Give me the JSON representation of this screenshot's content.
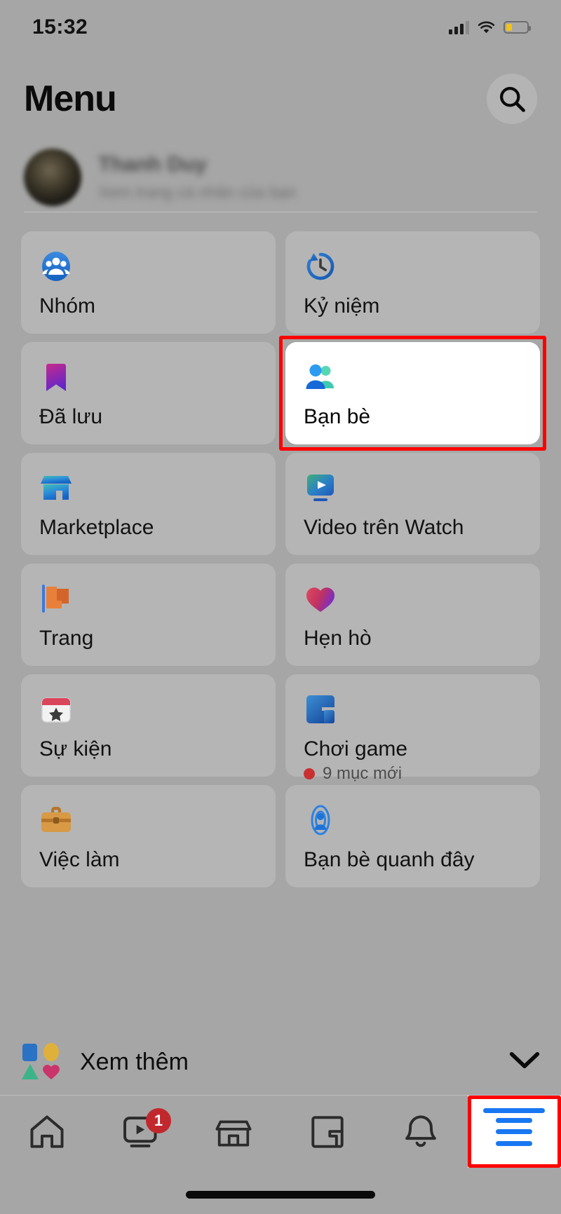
{
  "status_bar": {
    "time": "15:32",
    "signal_icon": "cellular-bars-icon",
    "wifi_icon": "wifi-icon",
    "battery_icon": "battery-low-icon",
    "battery_color": "#f0c419"
  },
  "header": {
    "title": "Menu",
    "search_icon": "search-icon"
  },
  "profile": {
    "name": "Thanh Duy",
    "subtitle": "Xem trang cá nhân của bạn",
    "avatar_icon": "avatar"
  },
  "tiles": [
    {
      "id": "groups",
      "label": "Nhóm",
      "icon": "groups-icon",
      "sub": null,
      "highlighted": false
    },
    {
      "id": "memories",
      "label": "Kỷ niệm",
      "icon": "memories-clock-icon",
      "sub": null,
      "highlighted": false
    },
    {
      "id": "saved",
      "label": "Đã lưu",
      "icon": "bookmark-icon",
      "sub": null,
      "highlighted": false
    },
    {
      "id": "friends",
      "label": "Bạn bè",
      "icon": "friends-icon",
      "sub": null,
      "highlighted": true
    },
    {
      "id": "marketplace",
      "label": "Marketplace",
      "icon": "marketplace-shop-icon",
      "sub": null,
      "highlighted": false
    },
    {
      "id": "watch",
      "label": "Video trên Watch",
      "icon": "watch-play-icon",
      "sub": null,
      "highlighted": false
    },
    {
      "id": "pages",
      "label": "Trang",
      "icon": "pages-flag-icon",
      "sub": null,
      "highlighted": false
    },
    {
      "id": "dating",
      "label": "Hẹn hò",
      "icon": "dating-heart-icon",
      "sub": null,
      "highlighted": false
    },
    {
      "id": "events",
      "label": "Sự kiện",
      "icon": "events-calendar-icon",
      "sub": null,
      "highlighted": false
    },
    {
      "id": "gaming",
      "label": "Chơi game",
      "icon": "gaming-icon",
      "sub": "9 mục mới",
      "highlighted": false
    },
    {
      "id": "jobs",
      "label": "Việc làm",
      "icon": "jobs-briefcase-icon",
      "sub": null,
      "highlighted": false
    },
    {
      "id": "friends-nearby",
      "label": "Bạn bè quanh đây",
      "icon": "nearby-friends-icon",
      "sub": null,
      "highlighted": false
    }
  ],
  "see_more": {
    "label": "Xem thêm",
    "shapes_icon": "shapes-icon",
    "chevron_icon": "chevron-down-icon"
  },
  "bottom_nav": [
    {
      "id": "home",
      "icon": "home-icon",
      "badge": null,
      "active": false
    },
    {
      "id": "watch",
      "icon": "watch-icon",
      "badge": "1",
      "active": false
    },
    {
      "id": "marketplace",
      "icon": "marketplace-icon",
      "badge": null,
      "active": false
    },
    {
      "id": "gaming",
      "icon": "gaming-icon",
      "badge": null,
      "active": false
    },
    {
      "id": "notifications",
      "icon": "bell-icon",
      "badge": null,
      "active": false
    },
    {
      "id": "menu",
      "icon": "hamburger-menu-icon",
      "badge": null,
      "active": true
    }
  ],
  "colors": {
    "highlight_border": "#ff0000",
    "facebook_blue": "#1877f2",
    "badge_red": "#c1282d",
    "dot_red": "#c93030"
  }
}
